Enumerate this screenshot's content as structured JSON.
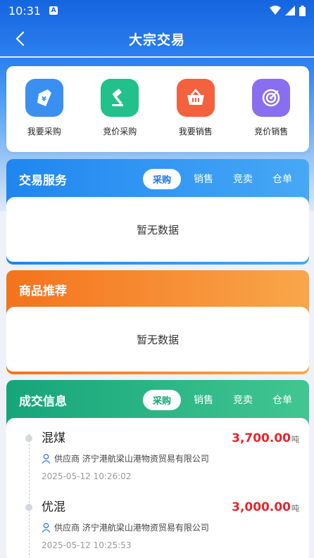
{
  "status": {
    "time": "10:31",
    "notif": "A"
  },
  "nav": {
    "title": "大宗交易"
  },
  "quick_actions": [
    {
      "label": "我要采购",
      "icon": "purchase-bag-icon",
      "color": "#3b8ff0"
    },
    {
      "label": "竞价采购",
      "icon": "auction-hammer-icon",
      "color": "#22c08a"
    },
    {
      "label": "我要销售",
      "icon": "basket-icon",
      "color": "#f4613f"
    },
    {
      "label": "竞价销售",
      "icon": "target-icon",
      "color": "#8a6ef0"
    }
  ],
  "trade_service": {
    "title": "交易服务",
    "tabs": [
      "采购",
      "销售",
      "竞卖",
      "仓单"
    ],
    "active_tab": "采购",
    "empty_text": "暂无数据"
  },
  "recommend": {
    "title": "商品推荐",
    "empty_text": "暂无数据"
  },
  "deals": {
    "title": "成交信息",
    "tabs": [
      "采购",
      "销售",
      "竞卖",
      "仓单"
    ],
    "active_tab": "采购",
    "items": [
      {
        "name": "混煤",
        "price": "3,700.00",
        "unit": "吨",
        "supplier": "供应商 济宁港航梁山港物资贸易有限公司",
        "time": "2025-05-12 10:26:02"
      },
      {
        "name": "优混",
        "price": "3,000.00",
        "unit": "吨",
        "supplier": "供应商 济宁港航梁山港物资贸易有限公司",
        "time": "2025-05-12 10:25:53"
      }
    ]
  },
  "colors": {
    "primary": "#1565e0",
    "price": "#e8262c",
    "green": "#16a579",
    "orange": "#f4731d"
  }
}
